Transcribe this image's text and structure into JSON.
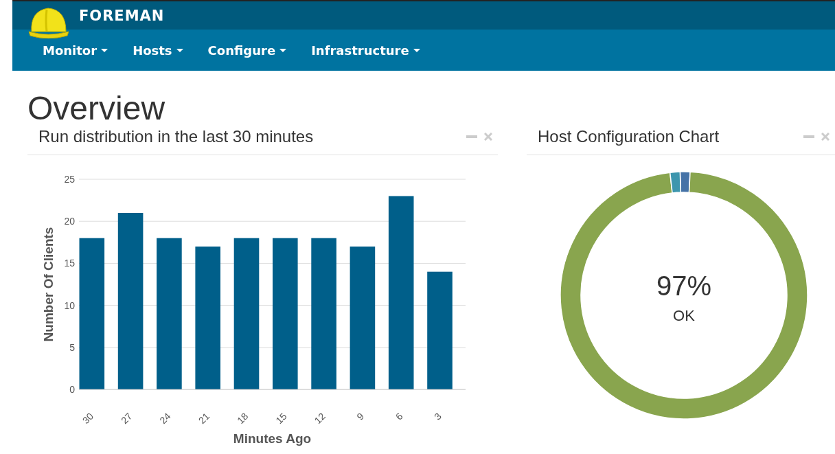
{
  "header": {
    "brand": "FOREMAN",
    "menu": [
      {
        "label": "Monitor",
        "dropdown": true
      },
      {
        "label": "Hosts",
        "dropdown": true
      },
      {
        "label": "Configure",
        "dropdown": true
      },
      {
        "label": "Infrastructure",
        "dropdown": true
      }
    ]
  },
  "page_title": "Overview",
  "widgets": [
    {
      "title": "Run distribution in the last 30 minutes",
      "chart_data": {
        "type": "bar",
        "xlabel": "Minutes Ago",
        "ylabel": "Number Of Clients",
        "categories": [
          "30",
          "27",
          "24",
          "21",
          "18",
          "15",
          "12",
          "9",
          "6",
          "3"
        ],
        "series": [
          {
            "color": "#005f8a",
            "values": [
              18,
              21,
              18,
              17,
              18,
              18,
              18,
              17,
              23,
              14
            ]
          }
        ],
        "grid": true,
        "ylim": [
          0,
          25
        ],
        "yticks": [
          0,
          5,
          10,
          15,
          20,
          25
        ]
      }
    },
    {
      "title": "Host Configuration Chart",
      "center_value": "97%",
      "center_label": "OK",
      "chart_data": {
        "type": "donut",
        "values": [
          1.3,
          97.4,
          1.3
        ],
        "colors": [
          "#4572a7",
          "#89a54e",
          "#3d96ae"
        ]
      }
    }
  ]
}
